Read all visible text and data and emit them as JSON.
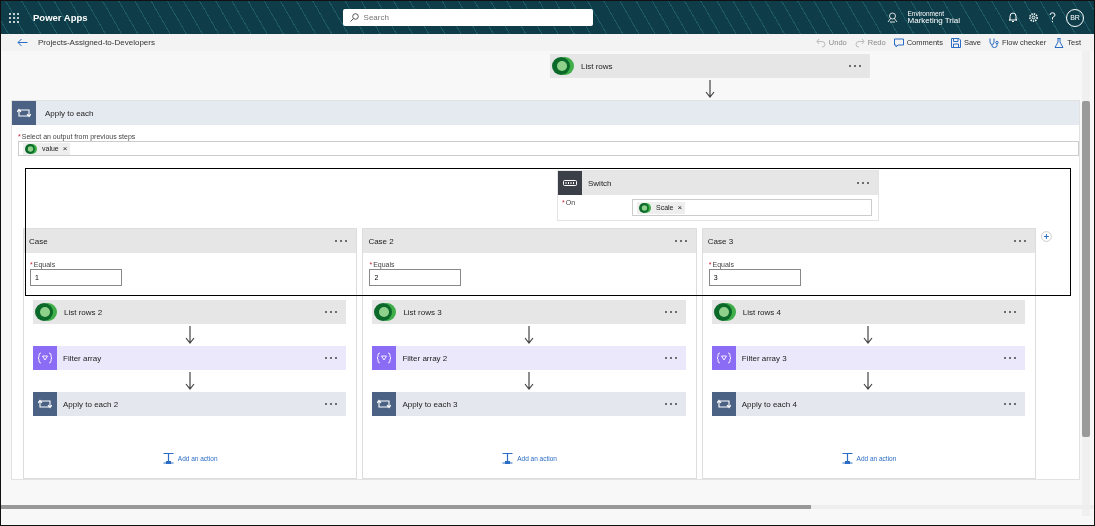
{
  "app": {
    "name": "Power Apps"
  },
  "search": {
    "placeholder": "Search"
  },
  "environment": {
    "label": "Environment",
    "name": "Marketing Trial"
  },
  "user": {
    "initials": "BR"
  },
  "flow": {
    "title": "Projects-Assigned-to-Developers"
  },
  "toolbar": [
    {
      "kind": "undo",
      "label": "Undo",
      "disabled": true
    },
    {
      "kind": "redo",
      "label": "Redo",
      "disabled": true
    },
    {
      "kind": "comments",
      "label": "Comments",
      "disabled": false
    },
    {
      "kind": "save",
      "label": "Save",
      "disabled": false
    },
    {
      "kind": "checker",
      "label": "Flow checker",
      "disabled": false
    },
    {
      "kind": "test",
      "label": "Test",
      "disabled": false
    }
  ],
  "top_action": {
    "kind": "dataverse",
    "title": "List rows"
  },
  "loop": {
    "title": "Apply to each",
    "field_label": "Select an output from previous steps",
    "required_mark": "*",
    "token": "value",
    "remove_mark": "×"
  },
  "switch": {
    "title": "Switch",
    "field_label": "On",
    "required_mark": "*",
    "token": "Scale",
    "remove_mark": "×"
  },
  "cases": [
    {
      "title": "Case",
      "field_label": "Equals",
      "required_mark": "*",
      "value": "1",
      "add_label": "Add an action",
      "actions": [
        {
          "kind": "dataverse",
          "title": "List rows 2"
        },
        {
          "kind": "filter",
          "title": "Filter array"
        },
        {
          "kind": "loop",
          "title": "Apply to each 2"
        }
      ]
    },
    {
      "title": "Case 2",
      "field_label": "Equals",
      "required_mark": "*",
      "value": "2",
      "add_label": "Add an action",
      "actions": [
        {
          "kind": "dataverse",
          "title": "List rows 3"
        },
        {
          "kind": "filter",
          "title": "Filter array 2"
        },
        {
          "kind": "loop",
          "title": "Apply to each 3"
        }
      ]
    },
    {
      "title": "Case 3",
      "field_label": "Equals",
      "required_mark": "*",
      "value": "3",
      "add_label": "Add an action",
      "actions": [
        {
          "kind": "dataverse",
          "title": "List rows 4"
        },
        {
          "kind": "filter",
          "title": "Filter array 3"
        },
        {
          "kind": "loop",
          "title": "Apply to each 4"
        }
      ]
    }
  ]
}
